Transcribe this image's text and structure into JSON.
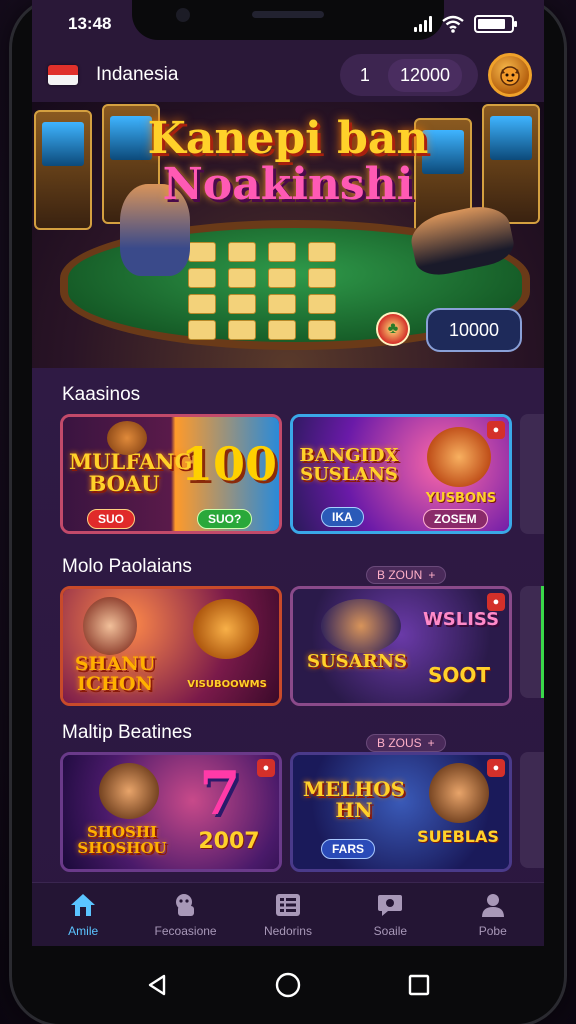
{
  "status_bar": {
    "time": "13:48"
  },
  "header": {
    "region": "Indanesia",
    "balance_prefix": "1",
    "balance_amount": "12000"
  },
  "banner": {
    "title_line1": "Kanepi ban",
    "title_line2": "Noakinshi",
    "amount": "10000"
  },
  "sections": [
    {
      "title": "Kaasinos",
      "cards": [
        {
          "title_line1": "MULFANG",
          "title_line2": "BOAU",
          "pill": "SUO",
          "big": "100",
          "pill2": "SUO?"
        },
        {
          "title_line1": "BANGIDX",
          "title_line2": "SUSLANS",
          "pill": "IKA",
          "sub": "YUSBONS",
          "pill2": "ZOSEM"
        }
      ]
    },
    {
      "title": "Molo Paolaians",
      "tag": "B ZOUN",
      "cards": [
        {
          "title_line1": "SHANU",
          "title_line2": "ICHON",
          "sub": "VISUBOOWMS"
        },
        {
          "title_line1": "SUSARNS",
          "title_line2": "",
          "sub": "WSLISS",
          "sub2": "SOOT"
        }
      ]
    },
    {
      "title": "Maltip Beatines",
      "tag": "B ZOUS",
      "cards": [
        {
          "title_line1": "SHOSHI",
          "title_line2": "SHOSHOU",
          "big": "7",
          "sub": "2007"
        },
        {
          "title_line1": "MELHOS",
          "title_line2": "HN",
          "pill": "FARS",
          "sub": "SUEBLAS"
        }
      ]
    }
  ],
  "bottom_nav": [
    {
      "label": "Amile",
      "icon": "home-icon",
      "active": true
    },
    {
      "label": "Fecoasione",
      "icon": "animal-icon",
      "active": false
    },
    {
      "label": "Nedorins",
      "icon": "grid-icon",
      "active": false
    },
    {
      "label": "Soaile",
      "icon": "chat-icon",
      "active": false
    },
    {
      "label": "Pobe",
      "icon": "person-icon",
      "active": false
    }
  ],
  "colors": {
    "accent": "#5bc4ff",
    "background": "#2f1a44",
    "gold": "#ffd12a"
  }
}
